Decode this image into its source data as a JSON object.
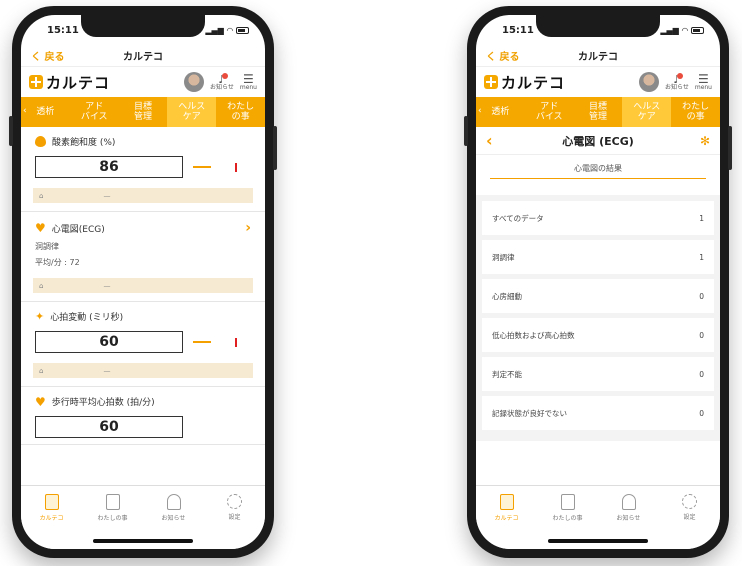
{
  "status": {
    "time": "15:11"
  },
  "nav": {
    "back": "く 戻る",
    "title": "カルテコ"
  },
  "brand": {
    "name": "カルテコ",
    "notify_label": "お知らせ",
    "menu_label": "menu"
  },
  "tabs": [
    "透析",
    "アド\nバイス",
    "目標\n管理",
    "ヘルス\nケア",
    "わたし\nの事"
  ],
  "left": {
    "spo2": {
      "title": "酸素飽和度 (%)",
      "value": "86",
      "note_dash": "—"
    },
    "ecg": {
      "title": "心電図(ECG)",
      "rhythm": "洞調律",
      "avg": "平均/分 : 72",
      "note_dash": "—"
    },
    "hrv": {
      "title": "心拍変動 (ミリ秒)",
      "value": "60",
      "note_dash": "—"
    },
    "walk": {
      "title": "歩行時平均心拍数 (拍/分)",
      "value": "60"
    }
  },
  "right": {
    "title": "心電図 (ECG)",
    "subtitle": "心電図の結果",
    "rows": [
      {
        "label": "すべてのデータ",
        "count": "1"
      },
      {
        "label": "洞調律",
        "count": "1"
      },
      {
        "label": "心房細動",
        "count": "0"
      },
      {
        "label": "低心拍数および高心拍数",
        "count": "0"
      },
      {
        "label": "判定不能",
        "count": "0"
      },
      {
        "label": "記録状態が良好でない",
        "count": "0"
      }
    ]
  },
  "bottom_nav": [
    {
      "label": "カルテコ",
      "icon": "clipboard-icon"
    },
    {
      "label": "わたしの事",
      "icon": "profile-card-icon"
    },
    {
      "label": "お知らせ",
      "icon": "bell-icon"
    },
    {
      "label": "設定",
      "icon": "gear-icon"
    }
  ],
  "colors": {
    "accent": "#f5a800",
    "accent_light": "#ffc93a",
    "alert": "#e02020"
  }
}
